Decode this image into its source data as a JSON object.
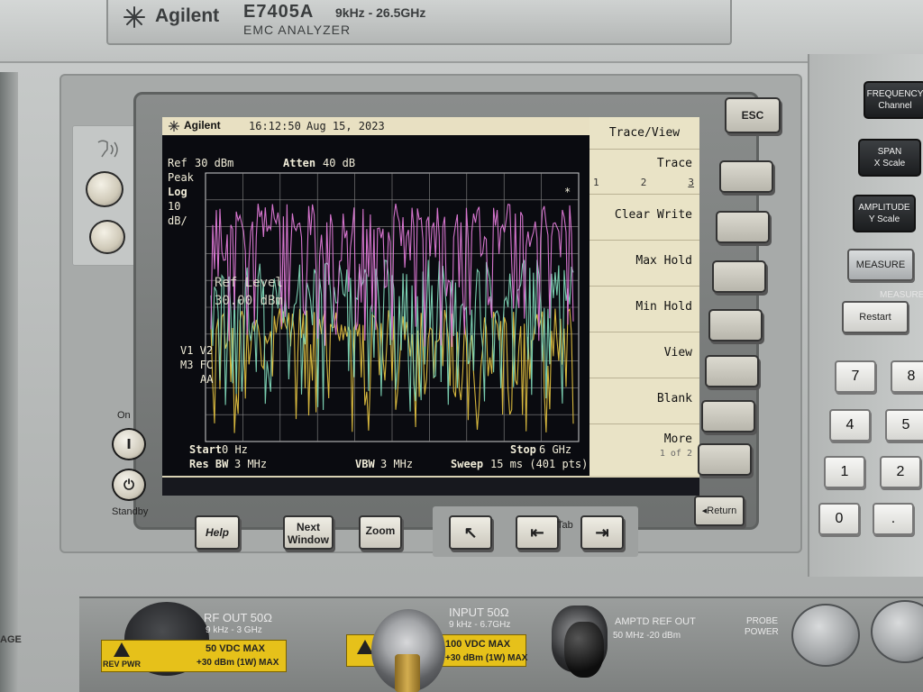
{
  "instrument": {
    "brand": "Agilent",
    "model": "E7405A",
    "freq_range": "9kHz - 26.5GHz",
    "description": "EMC ANALYZER"
  },
  "screen": {
    "brand": "Agilent",
    "time": "16:12:50",
    "date": "Aug 15, 2023",
    "ref_label": "Ref",
    "ref_value": "30 dBm",
    "atten_label": "Atten",
    "atten_value": "40 dB",
    "detector": "Peak",
    "scale_type": "Log",
    "scale_value": "10",
    "scale_unit": "dB/",
    "marker": "*",
    "ref_level_label": "Ref Level",
    "ref_level_value": "30.00 dBm",
    "flags_line1": "V1 V2",
    "flags_line2": "M3 FC",
    "flags_line3": "AA",
    "start_label": "Start",
    "start_value": "0 Hz",
    "stop_label": "Stop",
    "stop_value": "6 GHz",
    "rbw_label": "Res BW",
    "rbw_value": "3 MHz",
    "vbw_label": "VBW",
    "vbw_value": "3 MHz",
    "sweep_label": "Sweep",
    "sweep_value": "15 ms (401 pts)"
  },
  "menu": {
    "title": "Trace/View",
    "trace_label": "Trace",
    "trace_options": [
      "1",
      "2",
      "3"
    ],
    "clear_write": "Clear Write",
    "max_hold": "Max Hold",
    "min_hold": "Min Hold",
    "view": "View",
    "blank": "Blank",
    "more": "More",
    "more_page": "1 of 2"
  },
  "keys": {
    "esc": "ESC",
    "return": "Return",
    "help": "Help",
    "next_window_1": "Next",
    "next_window_2": "Window",
    "zoom": "Zoom",
    "tab": "Tab",
    "freq_1": "FREQUENCY",
    "freq_2": "Channel",
    "span_1": "SPAN",
    "span_2": "X Scale",
    "amp_1": "AMPLITUDE",
    "amp_2": "Y Scale",
    "measure": "MEASURE",
    "measure_faint": "MEASURE",
    "restart": "Restart",
    "num_7": "7",
    "num_8": "8",
    "num_4": "4",
    "num_5": "5",
    "num_1": "1",
    "num_2": "2",
    "num_0": "0",
    "num_dot": "."
  },
  "power": {
    "on_label": "On",
    "on_symbol": "I",
    "standby_label": "Standby",
    "standby_symbol": "⏻"
  },
  "connectors": {
    "rf_out_label": "RF OUT 50Ω",
    "rf_out_range": "9 kHz - 3 GHz",
    "rf_out_warn_1": "50 VDC  MAX",
    "rf_out_warn_2": "+30 dBm (1W) MAX",
    "rf_out_warn_prefix": "REV PWR",
    "input_label": "INPUT 50Ω",
    "input_range": "9 kHz - 6.7GHz",
    "input_warn_1": "100 VDC  MAX",
    "input_warn_2": "+30 dBm (1W) MAX",
    "amptd_ref_label": "AMPTD  REF OUT",
    "amptd_ref_sub": "50 MHz    -20 dBm",
    "probe_power_1": "PROBE",
    "probe_power_2": "POWER",
    "age_label": "AGE"
  },
  "colors": {
    "screen_bg": "#0a0b10",
    "trace_1": "#e07ad8",
    "trace_2": "#7fd7b8",
    "trace_3": "#e0c040",
    "softkey_bg": "#e9e3c6"
  }
}
